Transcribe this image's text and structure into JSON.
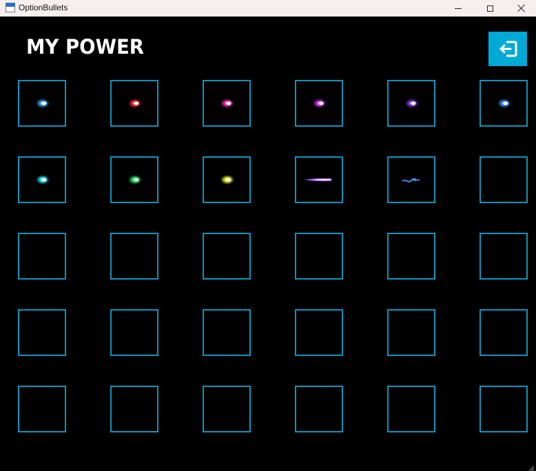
{
  "window": {
    "title": "OptionBullets",
    "minimize_icon": "minimize-icon",
    "maximize_icon": "maximize-icon",
    "close_icon": "close-icon"
  },
  "header": {
    "title": "MY POWER",
    "exit_icon": "exit-icon",
    "exit_color": "#00a9d6"
  },
  "colors": {
    "background": "#000000",
    "slot_border": "#0e95bd"
  },
  "grid": {
    "columns": 6,
    "rows": 5,
    "slots": [
      {
        "bullet": "blue-orb-bullet",
        "color": "#3aa8ff"
      },
      {
        "bullet": "red-orb-bullet",
        "color": "#ff2a3a"
      },
      {
        "bullet": "pink-orb-bullet",
        "color": "#ff2fb0"
      },
      {
        "bullet": "magenta-orb-bullet",
        "color": "#d52cff"
      },
      {
        "bullet": "violet-orb-bullet",
        "color": "#8a3cff"
      },
      {
        "bullet": "blue-orb-bullet",
        "color": "#3f8cff"
      },
      {
        "bullet": "cyan-orb-bullet",
        "color": "#22e0ff"
      },
      {
        "bullet": "green-orb-bullet",
        "color": "#1ee85a"
      },
      {
        "bullet": "yellow-orb-bullet",
        "color": "#e6f21a"
      },
      {
        "bullet": "purple-beam-bullet",
        "color": "#9a55ff"
      },
      {
        "bullet": "blue-squiggle-bullet",
        "color": "#4a86e6"
      },
      {
        "bullet": "empty"
      },
      {
        "bullet": "empty"
      },
      {
        "bullet": "empty"
      },
      {
        "bullet": "empty"
      },
      {
        "bullet": "empty"
      },
      {
        "bullet": "empty"
      },
      {
        "bullet": "empty"
      },
      {
        "bullet": "empty"
      },
      {
        "bullet": "empty"
      },
      {
        "bullet": "empty"
      },
      {
        "bullet": "empty"
      },
      {
        "bullet": "empty"
      },
      {
        "bullet": "empty"
      },
      {
        "bullet": "empty"
      },
      {
        "bullet": "empty"
      },
      {
        "bullet": "empty"
      },
      {
        "bullet": "empty"
      },
      {
        "bullet": "empty"
      },
      {
        "bullet": "empty"
      }
    ]
  }
}
